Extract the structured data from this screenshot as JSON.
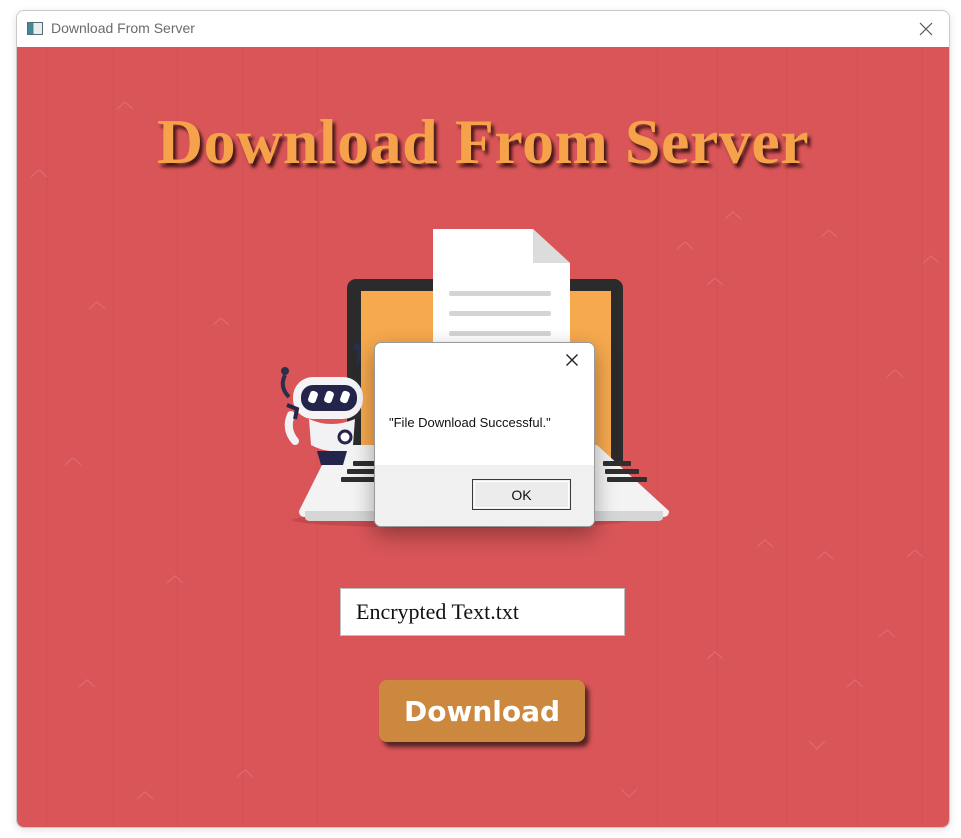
{
  "window": {
    "title": "Download From Server",
    "icon": "app-window-icon",
    "close_icon": "close-icon"
  },
  "main": {
    "heading": "Download From Server",
    "filename_value": "Encrypted Text.txt",
    "download_label": "Download",
    "background_color": "#d95558",
    "heading_color": "#f5a24b",
    "button_color": "#cd8840"
  },
  "dialog": {
    "message": "\"File Download Successful.\"",
    "ok_label": "OK",
    "close_icon": "close-icon"
  }
}
